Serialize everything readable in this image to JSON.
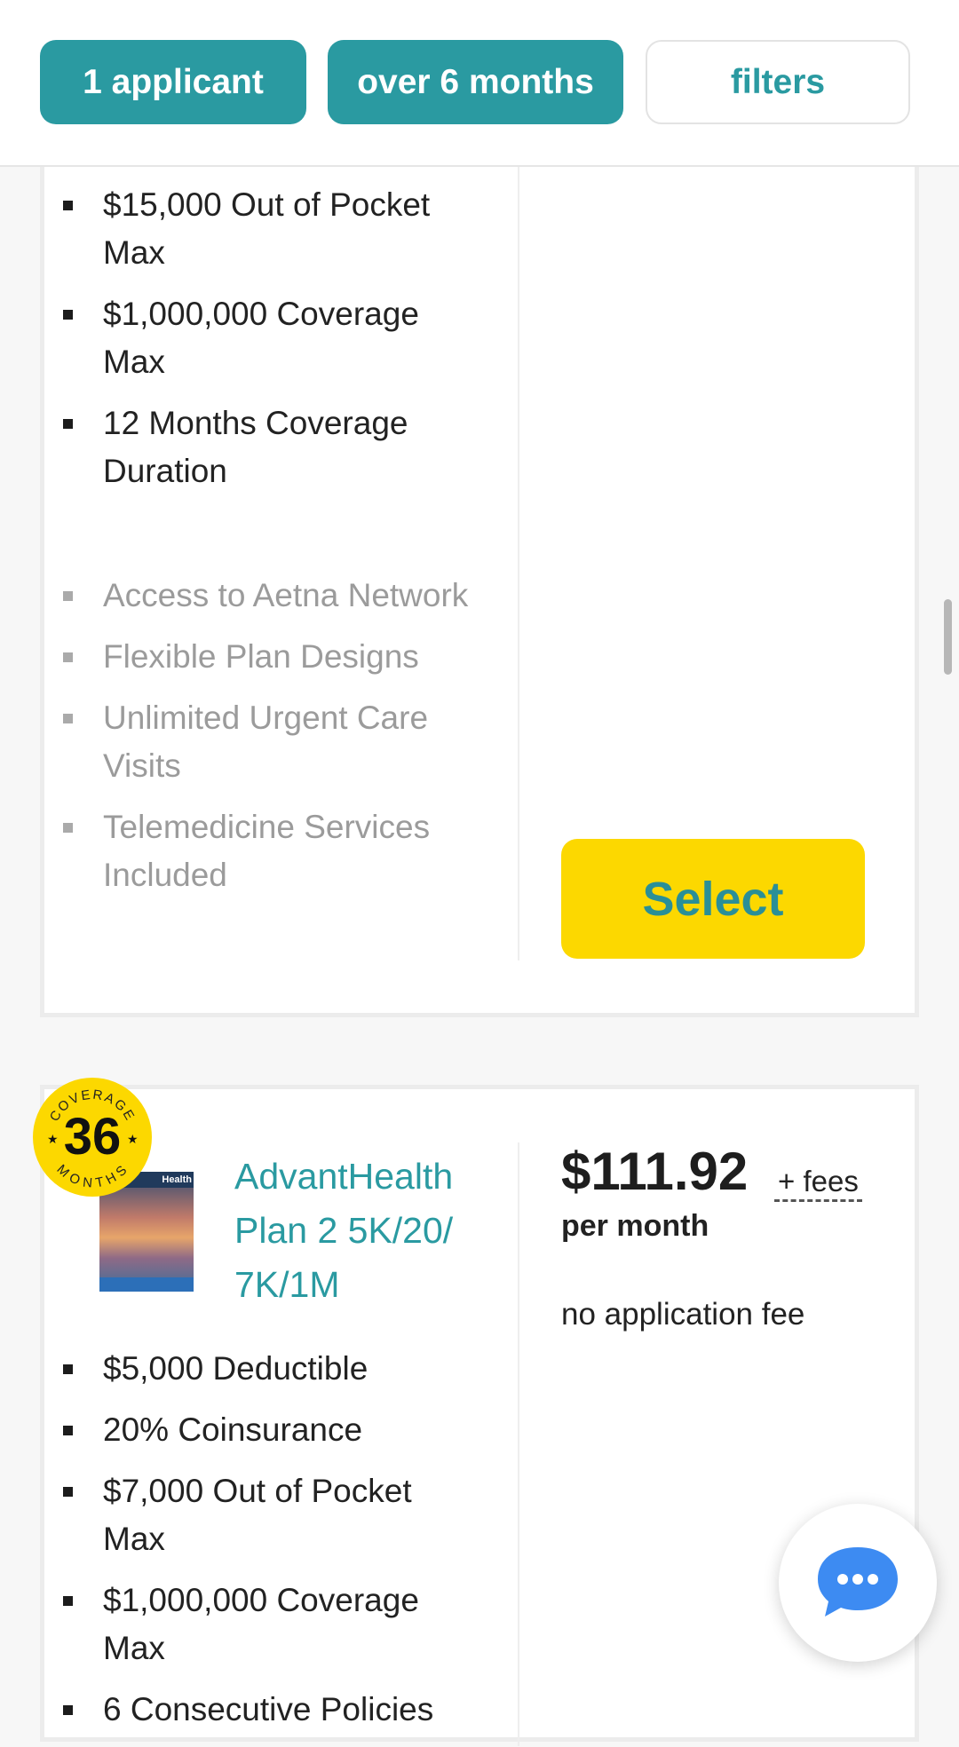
{
  "filters": {
    "applicants_label": "1 applicant",
    "duration_label": "over 6 months",
    "filters_label": "filters"
  },
  "plan_1": {
    "features": [
      "$15,000 Out of Pocket Max",
      "$1,000,000 Coverage Max",
      "12 Months Coverage Duration"
    ],
    "extras": [
      "Access to Aetna Network",
      "Flexible Plan Designs",
      "Unlimited Urgent Care Visits",
      "Telemedicine Services Included"
    ],
    "select_label": "Select"
  },
  "plan_2": {
    "badge": {
      "top": "COVERAGE",
      "number": "36",
      "bottom": "MONTHS"
    },
    "thumbnail_label": "Health",
    "name": "AdvantHealth Plan 2 5K/20/ 7K/1M",
    "price": "$111.92",
    "fees_label": "+ fees",
    "period_label": "per month",
    "application_fee": "no application fee",
    "features": [
      "$5,000 Deductible",
      "20% Coinsurance",
      "$7,000 Out of Pocket Max",
      "$1,000,000 Coverage Max",
      "6 Consecutive Policies"
    ]
  },
  "colors": {
    "teal": "#2a9aa1",
    "yellow": "#fcd800",
    "chat_blue": "#3d8bf2"
  },
  "icons": {
    "chat": "chat-bubble-icon"
  }
}
